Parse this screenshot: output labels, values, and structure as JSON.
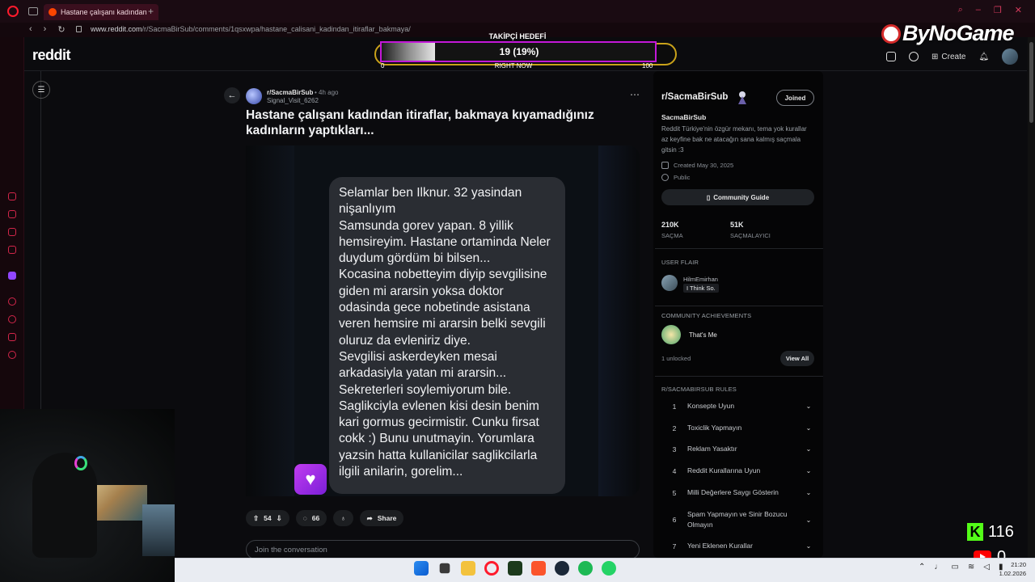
{
  "browser": {
    "tab_title": "Hastane çalışanı kadından",
    "url_domain": "www.reddit.com",
    "url_path": "/r/SacmaBirSub/comments/1qsxwpa/hastane_calisani_kadindan_itiraflar_bakmaya/"
  },
  "header": {
    "logo": "reddit",
    "create_label": "Create"
  },
  "overlay": {
    "goal_title": "TAKİPÇİ HEDEFİ",
    "goal_value": "19 (19%)",
    "goal_fraction": 0.19,
    "goal_min": "0",
    "goal_mid": "RIGHT NOW",
    "goal_max": "100",
    "brand": "ByNoGame",
    "kick_count": "116",
    "youtube_count": "0"
  },
  "post": {
    "subreddit": "r/SacmaBirSub",
    "time": "• 4h ago",
    "author": "Signal_Visit_6262",
    "title": "Hastane çalışanı kadından itiraflar, bakmaya kıyamadığınız kadınların yaptıkları...",
    "image_text": "Selamlar ben Ilknur. 32 yasindan nişanlıyım\nSamsunda gorev yapan. 8 yillik hemsireyim. Hastane ortaminda Neler duydum gördüm bi bilsen...\nKocasina nobetteyim diyip sevgilisine giden mi ararsin yoksa doktor odasinda gece nobetinde asistana veren hemsire mi ararsin belki sevgili oluruz da evleniriz diye.\nSevgilisi askerdeyken mesai arkadasiyla yatan mi ararsin...\nSekreterleri soylemiyorum bile.\nSaglikciyla evlenen kisi desin benim kari gormus gecirmistir. Cunku firsat cokk :) Bunu unutmayin. Yorumlara yazsin hatta kullanicilar saglikcilarla ilgili anilarin, gorelim...",
    "upvotes": "54",
    "comments": "66",
    "share_label": "Share",
    "join_placeholder": "Join the conversation"
  },
  "sidebar": {
    "title": "r/SacmaBirSub",
    "joined_label": "Joined",
    "name": "SacmaBirSub",
    "description": "Reddit Türkiye'nin özgür mekanı, tema yok kurallar az keyfine bak ne atacağın sana kalmış saçmala gitsin :3",
    "created": "Created May 30, 2025",
    "visibility": "Public",
    "guide_label": "Community Guide",
    "stat1_value": "210K",
    "stat1_label": "SAÇMA",
    "stat2_value": "51K",
    "stat2_label": "SAÇMALAYICI",
    "user_flair_heading": "USER FLAIR",
    "flair_user": "HilmEmirhan",
    "flair_text": "I Think So.",
    "achievements_heading": "COMMUNITY ACHIEVEMENTS",
    "achievement_name": "That's Me",
    "achievements_unlocked": "1 unlocked",
    "view_all_label": "View All",
    "rules_heading": "R/SACMABIRSUB RULES",
    "rules": [
      {
        "num": "1",
        "text": "Konsepte Uyun"
      },
      {
        "num": "2",
        "text": "Toxiclik Yapmayın"
      },
      {
        "num": "3",
        "text": "Reklam Yasaktır"
      },
      {
        "num": "4",
        "text": "Reddit Kurallarına Uyun"
      },
      {
        "num": "5",
        "text": "Milli Değerlere Saygı Gösterin"
      },
      {
        "num": "6",
        "text": "Spam Yapmayın ve Sinir Bozucu Olmayın"
      },
      {
        "num": "7",
        "text": "Yeni Eklenen Kurallar"
      }
    ]
  },
  "taskbar": {
    "time": "21:20",
    "date": "1.02.2026",
    "apps": [
      "windows-start-icon",
      "file-icon",
      "folder-icon",
      "opera-icon",
      "terminal-icon",
      "brave-icon",
      "steam-icon",
      "spotify-icon",
      "whatsapp-icon"
    ]
  },
  "colors": {
    "accent_purple": "#c318d8",
    "goal_border": "#c9a21a",
    "kick_green": "#53fc18",
    "youtube_red": "#ff0000",
    "opera_red": "#ff1b2d"
  }
}
